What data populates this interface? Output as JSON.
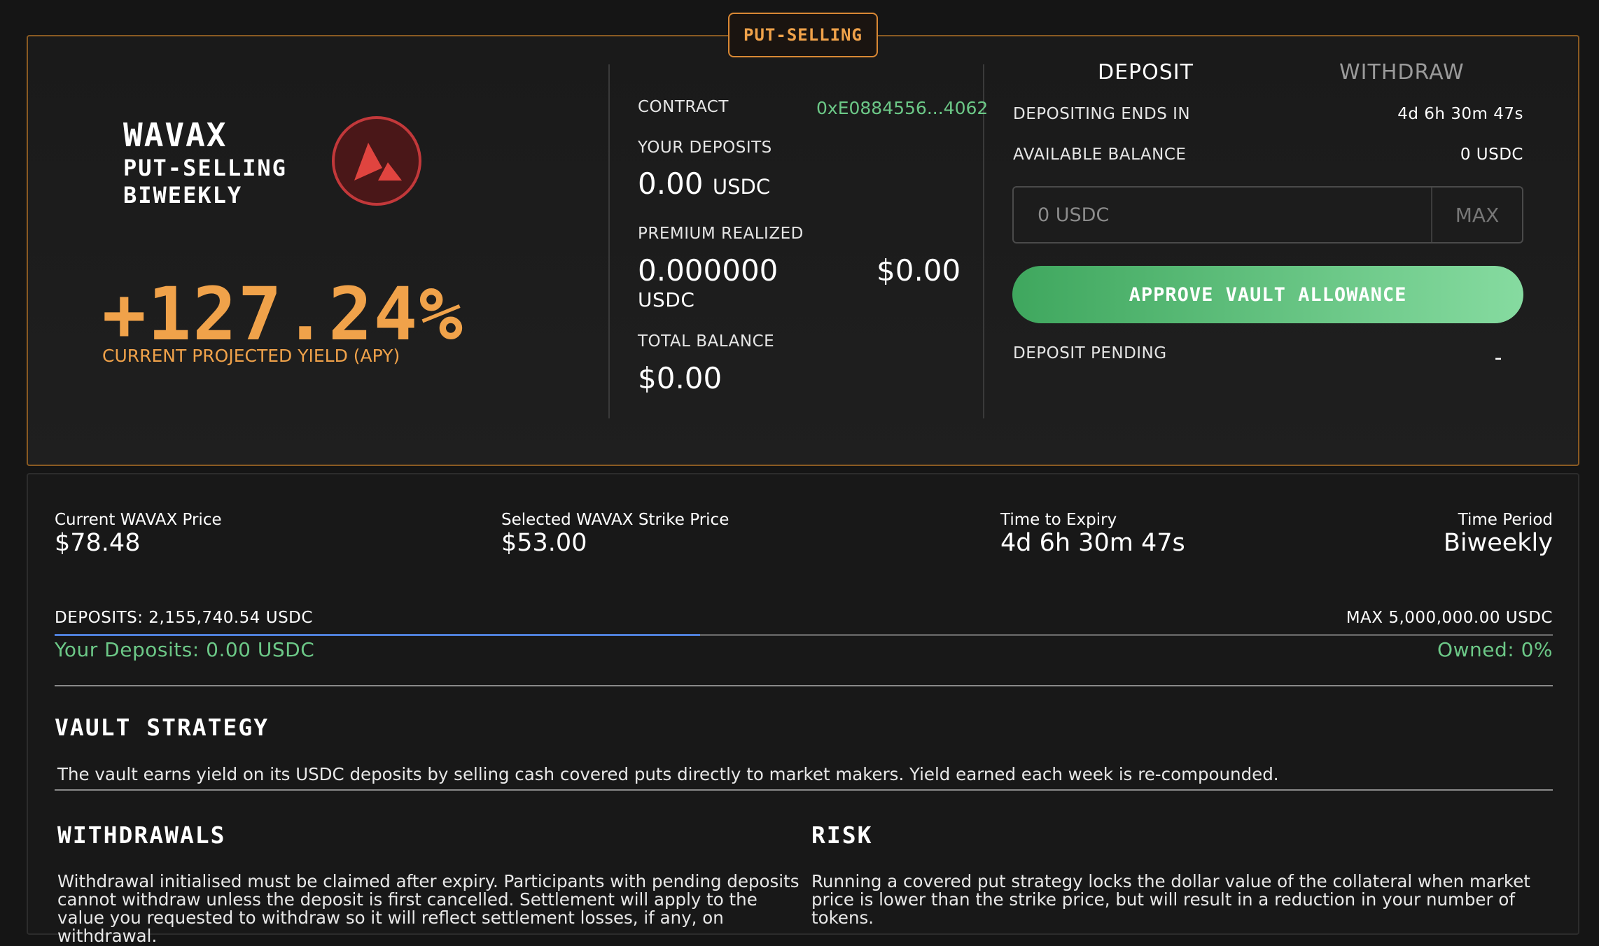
{
  "badge": "PUT-SELLING",
  "vault": {
    "name_line1": "WAVAX",
    "name_line2": "PUT-SELLING",
    "name_line3": "BIWEEKLY",
    "logo_icon": "avalanche-logo-icon",
    "apy": "+127.24%",
    "apy_label": "CURRENT PROJECTED YIELD (APY)"
  },
  "stats": {
    "contract_label": "CONTRACT",
    "contract_value": "0xE0884556...4062",
    "your_deposits_label": "YOUR DEPOSITS",
    "your_deposits_value": "0.00",
    "your_deposits_unit": "USDC",
    "premium_label": "PREMIUM REALIZED",
    "premium_value": "0.000000",
    "premium_unit": "USDC",
    "premium_usd": "$0.00",
    "total_label": "TOTAL BALANCE",
    "total_value": "$0.00"
  },
  "panel": {
    "tab_deposit": "DEPOSIT",
    "tab_withdraw": "WITHDRAW",
    "ends_label": "DEPOSITING ENDS IN",
    "ends_value": "4d 6h 30m 47s",
    "balance_label": "AVAILABLE BALANCE",
    "balance_value": "0 USDC",
    "input_placeholder": "0 USDC",
    "max_label": "MAX",
    "approve_label": "APPROVE VAULT ALLOWANCE",
    "pending_label": "DEPOSIT PENDING",
    "pending_value": "-"
  },
  "info": {
    "price_label": "Current WAVAX Price",
    "price_value": "$78.48",
    "strike_label": "Selected WAVAX Strike Price",
    "strike_value": "$53.00",
    "expiry_label": "Time to Expiry",
    "expiry_value": "4d 6h 30m 47s",
    "period_label": "Time Period",
    "period_value": "Biweekly"
  },
  "capacity": {
    "deposits_text": "DEPOSITS: 2,155,740.54 USDC",
    "max_text": "MAX 5,000,000.00 USDC",
    "your_deposits_text": "Your Deposits: 0.00 USDC",
    "owned_text": "Owned: 0%",
    "fill_fraction": 0.431
  },
  "strategy": {
    "title": "VAULT STRATEGY",
    "text": "The vault earns yield on its USDC deposits by selling cash covered puts directly to market makers. Yield earned each week is re-compounded."
  },
  "withdrawals": {
    "title": "WITHDRAWALS",
    "text": "Withdrawal initialised must be claimed after expiry. Participants with pending deposits cannot withdraw unless the deposit is first cancelled. Settlement will apply to the value you requested to withdraw so it will reflect settlement losses, if any, on withdrawal."
  },
  "risk": {
    "title": "RISK",
    "text": "Running a covered put strategy locks the dollar value of the collateral when market price is lower than the strike price, but will result in a reduction in your number of tokens."
  },
  "colors": {
    "accent_orange": "#f0a24a",
    "accent_green": "#6cc887",
    "progress_blue": "#4f7fd8"
  }
}
